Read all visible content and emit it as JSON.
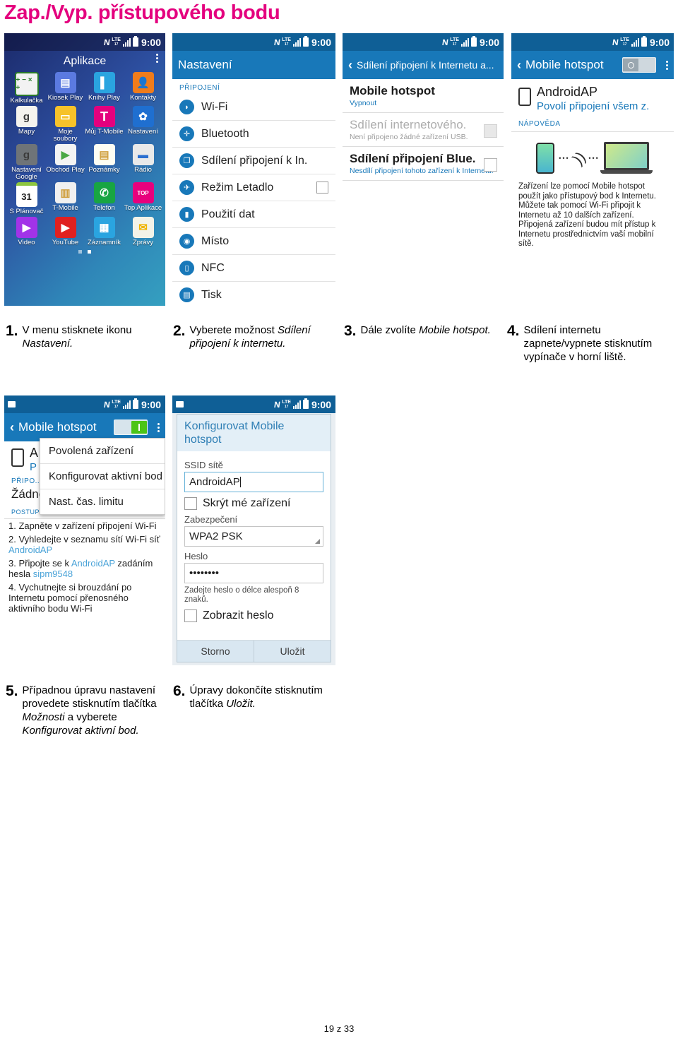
{
  "page": {
    "title": "Zap./Vyp. přístupového bodu",
    "title_color": "#E4007E",
    "footer": "19 z 33"
  },
  "statusbar": {
    "nfc": "N",
    "lte_top": "LTE",
    "lte_bottom": "17",
    "clock": "9:00"
  },
  "panel1": {
    "name": "app-drawer",
    "title": "Aplikace",
    "apps": [
      {
        "label": "Kalkulačka",
        "glyph": "+ −\n× +",
        "bg": "#f2f2f2"
      },
      {
        "label": "Kiosek Play",
        "glyph": "▤",
        "bg": "#5b7ae0"
      },
      {
        "label": "Knihy Play",
        "glyph": "▌",
        "bg": "#2aa4e0"
      },
      {
        "label": "Kontakty",
        "glyph": "👤",
        "bg": "#f07c1b"
      },
      {
        "label": "Mapy",
        "glyph": "g",
        "bg": "#f5f3ee"
      },
      {
        "label": "Moje soubory",
        "glyph": "▭",
        "bg": "#f6c22a"
      },
      {
        "label": "Můj T-Mobile",
        "glyph": "T",
        "bg": "#e4007e"
      },
      {
        "label": "Nastavení",
        "glyph": "✿",
        "bg": "#1f6fd0"
      },
      {
        "label": "Nastavení Google",
        "glyph": "g",
        "bg": "#6f7478"
      },
      {
        "label": "Obchod Play",
        "glyph": "▶",
        "bg": "#f3f3f3"
      },
      {
        "label": "Poznámky",
        "glyph": "▤",
        "bg": "#fdfdf3"
      },
      {
        "label": "Rádio",
        "glyph": "▬",
        "bg": "#e9e9e9"
      },
      {
        "label": "S Plánovač",
        "glyph": "31",
        "bg": "#ffffff"
      },
      {
        "label": "T-Mobile",
        "glyph": "▥",
        "bg": "#f0f0f0"
      },
      {
        "label": "Telefon",
        "glyph": "✆",
        "bg": "#18a542"
      },
      {
        "label": "Top Aplikace",
        "glyph": "TOP",
        "bg": "#e8007d"
      },
      {
        "label": "Video",
        "glyph": "▶",
        "bg": "#a233e8"
      },
      {
        "label": "YouTube",
        "glyph": "▶",
        "bg": "#e02020"
      },
      {
        "label": "Záznamník",
        "glyph": "▦",
        "bg": "#2aa4e0"
      },
      {
        "label": "Zprávy",
        "glyph": "✉",
        "bg": "#f3f3e8"
      }
    ]
  },
  "panel2": {
    "name": "settings-list",
    "actionbar_title": "Nastavení",
    "section": "PŘIPOJENÍ",
    "rows": [
      {
        "label": "Wi-Fi",
        "icon": "wifi-icon",
        "glyph": "◗",
        "checkbox": false
      },
      {
        "label": "Bluetooth",
        "icon": "bluetooth-icon",
        "glyph": "✛",
        "checkbox": false
      },
      {
        "label": "Sdílení připojení k In.",
        "icon": "tethering-icon",
        "glyph": "❐",
        "checkbox": false
      },
      {
        "label": "Režim Letadlo",
        "icon": "airplane-icon",
        "glyph": "✈",
        "checkbox": true
      },
      {
        "label": "Použití dat",
        "icon": "data-usage-icon",
        "glyph": "▮",
        "checkbox": false
      },
      {
        "label": "Místo",
        "icon": "location-icon",
        "glyph": "◉",
        "checkbox": false
      },
      {
        "label": "NFC",
        "icon": "nfc-icon",
        "glyph": "▯",
        "checkbox": false
      },
      {
        "label": "Tisk",
        "icon": "print-icon",
        "glyph": "▤",
        "checkbox": false
      }
    ]
  },
  "panel3": {
    "name": "tethering-screen",
    "actionbar_title": "Sdílení připojení k Internetu a...",
    "rows": [
      {
        "title": "Mobile hotspot",
        "subtitle": "Vypnout",
        "dim": false,
        "box": false
      },
      {
        "title": "Sdílení internetového.",
        "subtitle": "Není připojeno žádné zařízení USB.",
        "dim": true,
        "box": true
      },
      {
        "title": "Sdílení připojení Blue.",
        "subtitle": "Nesdílí připojení tohoto zařízení k Internetu.",
        "dim": false,
        "box": true
      }
    ]
  },
  "panel4": {
    "name": "mobile-hotspot-off",
    "actionbar_title": "Mobile hotspot",
    "toggle_state": "off",
    "ap_name": "AndroidAP",
    "ap_sub": "Povolí připojení všem z.",
    "section": "NÁPOVĚDA",
    "help_text": "Zařízení lze pomocí Mobile hotspot použít jako přístupový bod k Internetu. Můžete tak pomocí Wi-Fi připojit k Internetu až 10 dalších zařízení. Připojená zařízení budou mít přístup k Internetu prostřednictvím vaší mobilní sítě."
  },
  "panel5": {
    "name": "mobile-hotspot-on-menu",
    "actionbar_title": "Mobile hotspot",
    "toggle_state": "on",
    "ap_name": "A",
    "ap_sub": "P",
    "section_connected": "PŘIPO...",
    "no_devices": "Žádné zaříz...",
    "menu_items": [
      "Povolená zařízení",
      "Konfigurovat aktivní bod",
      "Nast. čas. limitu"
    ],
    "section_howto": "POSTUP PŘIPOJENÍ Z JINÝCH ZAŘÍZENÍ",
    "steps": [
      {
        "text": "1. Zapněte v zařízení připojení Wi-Fi",
        "hl": ""
      },
      {
        "text": "2. Vyhledejte v seznamu sítí Wi-Fi síť ",
        "hl": "AndroidAP"
      },
      {
        "text": "3. Připojte se k ",
        "hl": "AndroidAP",
        "text2": " zadáním hesla ",
        "hl2": "sipm9548"
      },
      {
        "text": "4. Vychutnejte si brouzdání po Internetu pomocí přenosného aktivního bodu Wi-Fi",
        "hl": ""
      }
    ]
  },
  "panel6": {
    "name": "configure-hotspot-dialog",
    "dialog_title": "Konfigurovat Mobile hotspot",
    "ssid_label": "SSID sítě",
    "ssid_value": "AndroidAP",
    "hide_device_label": "Skrýt mé zařízení",
    "security_label": "Zabezpečení",
    "security_value": "WPA2 PSK",
    "password_label": "Heslo",
    "password_value": "••••••••",
    "password_hint": "Zadejte heslo o délce alespoň 8 znaků.",
    "show_password_label": "Zobrazit heslo",
    "cancel_label": "Storno",
    "save_label": "Uložit"
  },
  "captions": [
    {
      "num": "1.",
      "parts": [
        {
          "t": "V menu stisknete ikonu "
        },
        {
          "t": "Nastavení.",
          "i": true
        }
      ]
    },
    {
      "num": "2.",
      "parts": [
        {
          "t": "Vyberete možnost "
        },
        {
          "t": "Sdílení připojení k internetu.",
          "i": true
        }
      ]
    },
    {
      "num": "3.",
      "parts": [
        {
          "t": "Dále zvolíte "
        },
        {
          "t": "Mobile hotspot.",
          "i": true
        }
      ]
    },
    {
      "num": "4.",
      "parts": [
        {
          "t": "Sdílení internetu zapnete/vypnete stisknutím vypínače v horní liště."
        }
      ]
    },
    {
      "num": "5.",
      "parts": [
        {
          "t": "Případnou úpravu nastavení provedete stisknutím tlačítka "
        },
        {
          "t": "Možnosti",
          "i": true
        },
        {
          "t": " a vyberete "
        },
        {
          "t": "Konfigurovat aktivní bod.",
          "i": true
        }
      ]
    },
    {
      "num": "6.",
      "parts": [
        {
          "t": "Úpravy dokončíte stisknutím tlačítka "
        },
        {
          "t": "Uložit.",
          "i": true
        }
      ]
    }
  ]
}
